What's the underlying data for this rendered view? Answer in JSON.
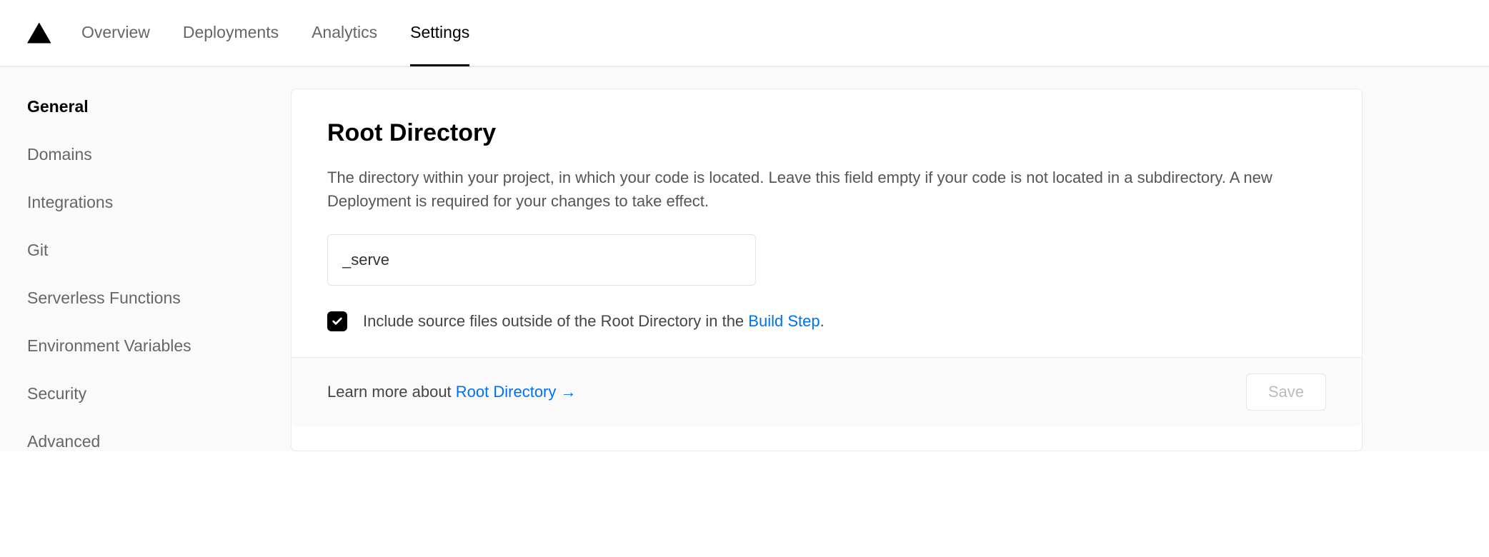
{
  "nav": {
    "items": [
      "Overview",
      "Deployments",
      "Analytics",
      "Settings"
    ],
    "active_index": 3
  },
  "sidebar": {
    "items": [
      "General",
      "Domains",
      "Integrations",
      "Git",
      "Serverless Functions",
      "Environment Variables",
      "Security",
      "Advanced"
    ],
    "active_index": 0
  },
  "card": {
    "title": "Root Directory",
    "description": "The directory within your project, in which your code is located. Leave this field empty if your code is not located in a subdirectory. A new Deployment is required for your changes to take effect.",
    "input_value": "_serve",
    "checkbox": {
      "checked": true,
      "label_prefix": "Include source files outside of the Root Directory in the ",
      "link_text": "Build Step",
      "label_suffix": "."
    },
    "footer": {
      "learn_prefix": "Learn more about ",
      "learn_link": "Root Directory →",
      "save_label": "Save"
    }
  }
}
